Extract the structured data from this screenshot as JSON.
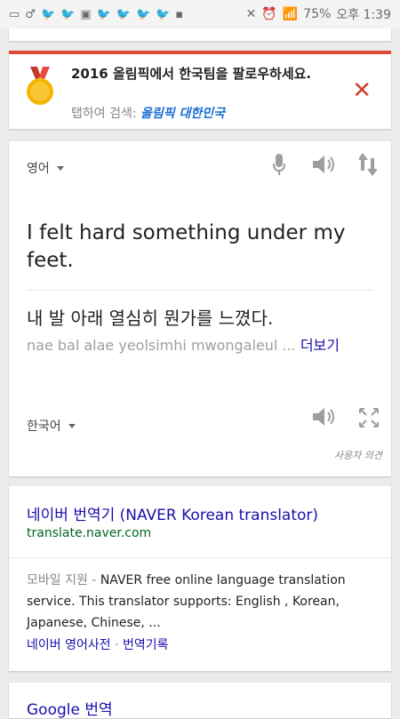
{
  "status_bar": {
    "icons": [
      "chat-icon",
      "male-icon",
      "twitter-icon",
      "twitter-icon",
      "bus-icon",
      "twitter-icon",
      "twitter-icon",
      "twitter-icon",
      "twitter-icon",
      "app-icon"
    ],
    "battery": "75%",
    "time": "오후 1:39"
  },
  "olympic_card": {
    "title": "2016 올림픽에서 한국팀을 팔로우하세요.",
    "sub_prefix": "탭하여 검색:",
    "sub_query": "올림픽 대한민국",
    "close": "✕"
  },
  "translate": {
    "source_lang": "영어",
    "source_text": "I felt hard something under my feet.",
    "target_text": "내 발 아래 열심히 뭔가를 느꼈다.",
    "romanized": "nae bal alae yeolsimhi mwongaleul ...",
    "more": "더보기",
    "target_lang": "한국어",
    "feedback": "사용자 의견"
  },
  "result": {
    "title": "네이버 번역기 (NAVER Korean translator)",
    "url": "translate.naver.com",
    "meta": "모바일 지원 -",
    "snippet": "NAVER free online language translation service. This translator supports: English , Korean, Japanese, Chinese, ...",
    "link1": "네이버 영어사전",
    "sep": "·",
    "link2": "번역기록"
  },
  "google": {
    "title": "Google 번역"
  },
  "colors": {
    "accent_red": "#dd4b39",
    "link_blue": "#1a0dab",
    "url_green": "#006621"
  }
}
